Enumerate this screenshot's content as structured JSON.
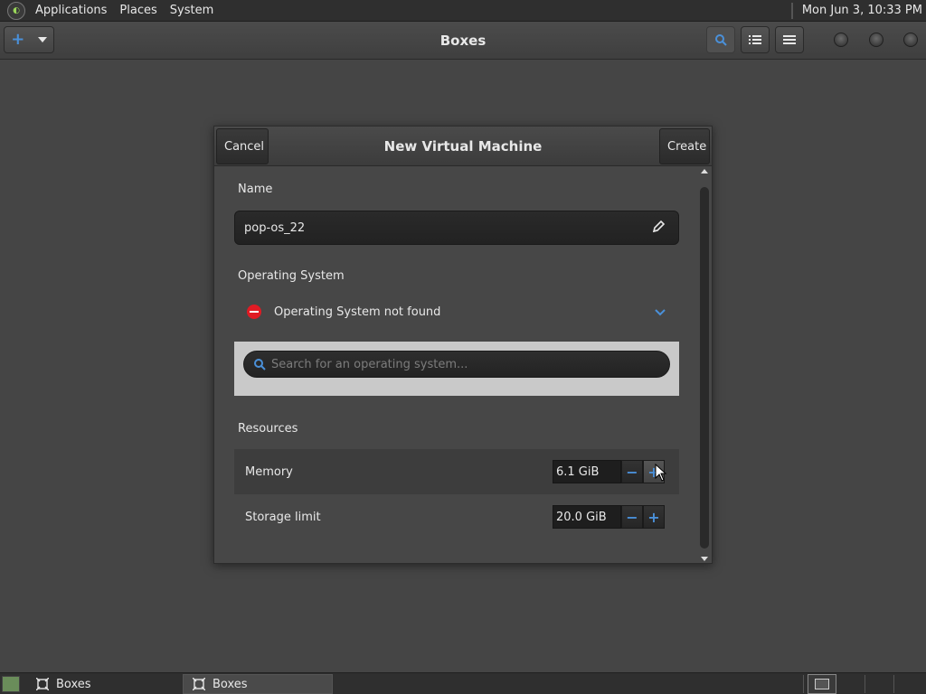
{
  "top_panel": {
    "menus": [
      "Applications",
      "Places",
      "System"
    ],
    "clock": "Mon Jun  3, 10:33 PM"
  },
  "header": {
    "title": "Boxes",
    "icons": {
      "new": "plus-icon",
      "dropdown": "caret-down-icon",
      "search": "search-icon",
      "view": "list-view-icon",
      "menu": "hamburger-menu-icon"
    }
  },
  "dialog": {
    "title": "New Virtual Machine",
    "cancel_label": "Cancel",
    "create_label": "Create",
    "name_label": "Name",
    "name_value": "pop-os_22",
    "os_label": "Operating System",
    "os_status": "Operating System not found",
    "search_placeholder": "Search for an operating system...",
    "resources_label": "Resources",
    "memory_label": "Memory",
    "memory_value": "6.1 GiB",
    "storage_label": "Storage limit",
    "storage_value": "20.0 GiB",
    "minus_symbol": "−",
    "plus_symbol": "+"
  },
  "taskbar": {
    "tasks": [
      "Boxes",
      "Boxes"
    ]
  },
  "colors": {
    "accent": "#4a90d9",
    "error": "#e01b24",
    "background": "#454545"
  }
}
